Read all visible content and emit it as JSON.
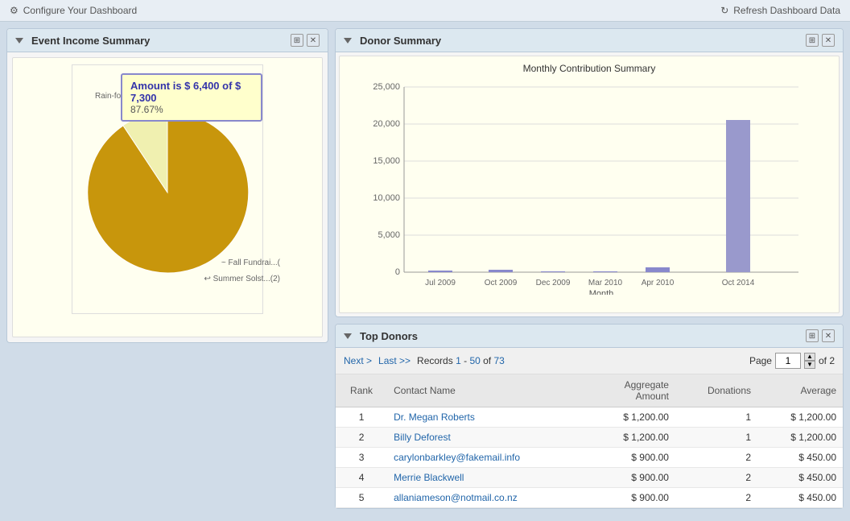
{
  "topBar": {
    "configure": "Configure Your Dashboard",
    "refresh": "Refresh Dashboard Data"
  },
  "eventIncome": {
    "title": "Event Income Summary",
    "tooltip": {
      "amount": "Amount is $ 6,400 of $ 7,300",
      "percent": "87.67%"
    },
    "slices": [
      {
        "label": "Rain-forest ...(3)",
        "value": 87.67,
        "color": "#c8960c",
        "large": true
      },
      {
        "label": "Fall Fundrai...(",
        "value": 6.0,
        "color": "#e8e860",
        "large": false
      },
      {
        "label": "Summer Solst...(2)",
        "value": 6.33,
        "color": "#f0f0b0",
        "large": false
      }
    ]
  },
  "donorSummary": {
    "title": "Donor Summary",
    "chart": {
      "title": "Monthly Contribution Summary",
      "xLabel": "Month",
      "yMax": 25000,
      "labels": [
        "Jul 2009",
        "Oct 2009",
        "Dec 2009",
        "Mar 2010",
        "Apr 2010",
        "Oct 2014"
      ],
      "values": [
        200,
        300,
        100,
        100,
        700,
        20500
      ]
    }
  },
  "topDonors": {
    "title": "Top Donors",
    "pagination": {
      "next": "Next >",
      "last": "Last >>",
      "records": "Records",
      "recordsFrom": "1",
      "recordsTo": "50",
      "recordsTotal": "73",
      "page": "Page",
      "currentPage": "1",
      "totalPages": "2"
    },
    "columns": {
      "rank": "Rank",
      "contact": "Contact Name",
      "aggregate": "Aggregate",
      "amount": "Amount",
      "donations": "Donations",
      "average": "Average"
    },
    "rows": [
      {
        "rank": 1,
        "name": "Dr. Megan Roberts",
        "aggregate": "$ 1,200.00",
        "donations": 1,
        "average": "$ 1,200.00"
      },
      {
        "rank": 2,
        "name": "Billy Deforest",
        "aggregate": "$ 1,200.00",
        "donations": 1,
        "average": "$ 1,200.00"
      },
      {
        "rank": 3,
        "name": "carylonbarkley@fakemail.info",
        "aggregate": "$ 900.00",
        "donations": 2,
        "average": "$ 450.00"
      },
      {
        "rank": 4,
        "name": "Merrie Blackwell",
        "aggregate": "$ 900.00",
        "donations": 2,
        "average": "$ 450.00"
      },
      {
        "rank": 5,
        "name": "allaniameson@notmail.co.nz",
        "aggregate": "$ 900.00",
        "donations": 2,
        "average": "$ 450.00"
      }
    ]
  }
}
